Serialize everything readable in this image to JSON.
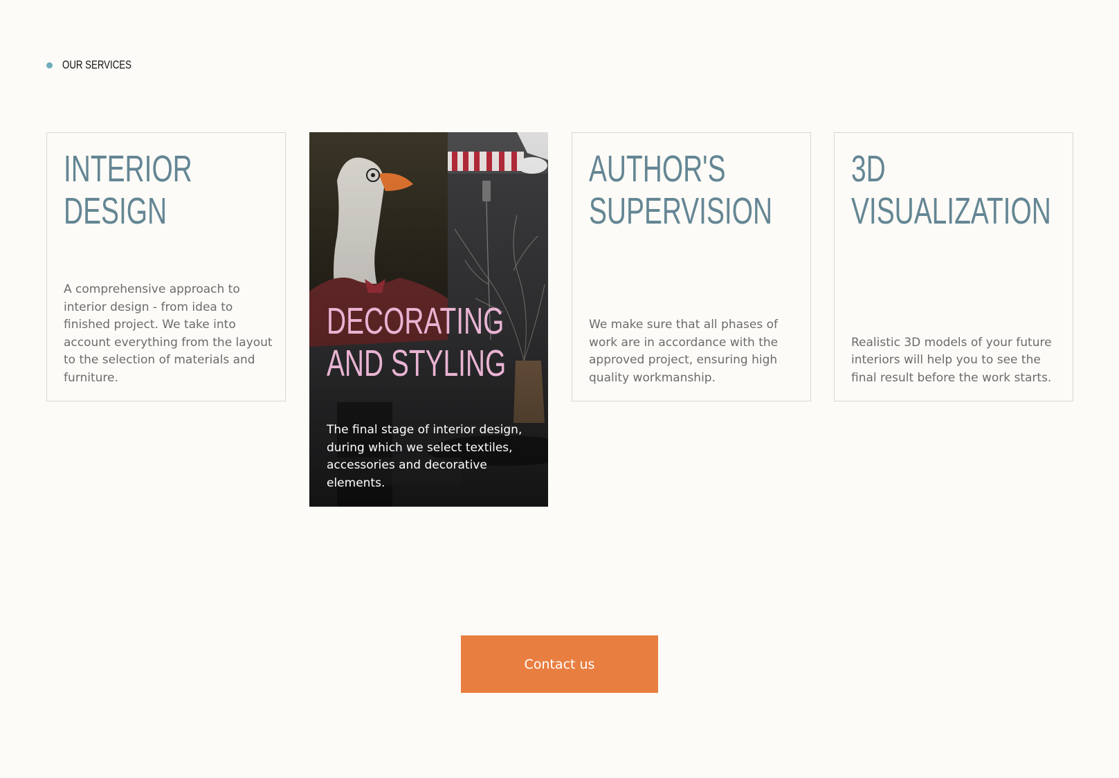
{
  "section": {
    "label": "OUR SERVICES"
  },
  "cards": [
    {
      "title": "INTERIOR\nDESIGN",
      "description": "A comprehensive approach to interior design - from idea to finished project. We take into account everything from the layout to the selection of materials and furniture."
    },
    {
      "title": "DECORATING\nAND STYLING",
      "description": "The final stage of interior design, during which we select textiles, accessories and decorative elements."
    },
    {
      "title": "AUTHOR'S\nSUPERVISION",
      "description": "We make sure that all phases of work are in accordance with the approved project, ensuring high quality workmanship."
    },
    {
      "title": "3D\nVISUALIZATION",
      "description": "Realistic 3D models of your future interiors will help you to see the final result before the work starts."
    }
  ],
  "cta": {
    "label": "Contact us"
  },
  "colors": {
    "background": "#fdfbf7",
    "title": "#648694",
    "featured_title": "#e9b4d3",
    "accent_dot": "#6fadbd",
    "button": "#e97e41"
  }
}
